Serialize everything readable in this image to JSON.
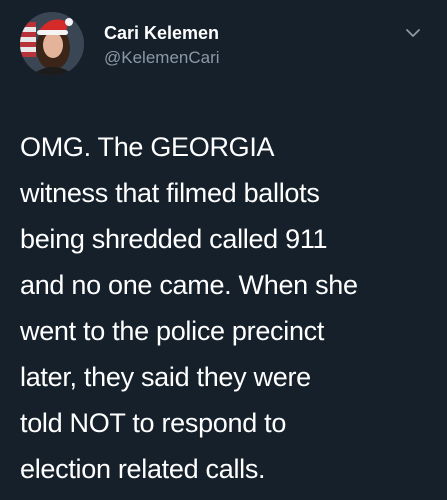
{
  "author": {
    "display_name": "Cari Kelemen",
    "handle": "@KelemenCari",
    "avatar_icon": "profile-photo-santa-hat"
  },
  "menu_icon": "chevron-down-icon",
  "tweet": {
    "lines": [
      "OMG. The GEORGIA",
      "witness that filmed ballots",
      "being shredded called 911",
      "and no one came. When she",
      "went to the police precinct",
      "later, they said they were",
      "told NOT to respond to",
      "election related calls."
    ]
  },
  "colors": {
    "background": "#15202b",
    "text": "#ffffff",
    "secondary_text": "#8b98a5"
  }
}
